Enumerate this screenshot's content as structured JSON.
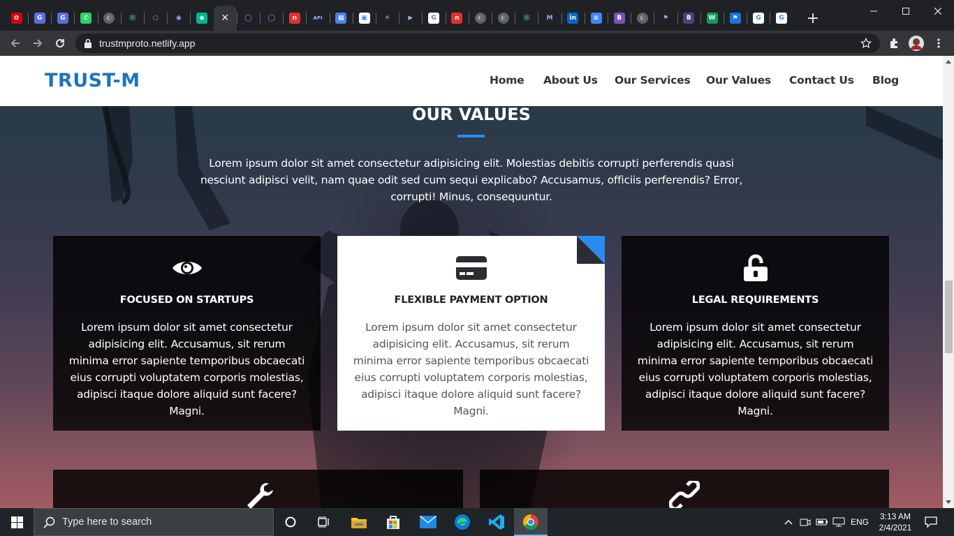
{
  "browser": {
    "tabs": [
      {
        "icon": "huawei-icon",
        "color": "#d7000f",
        "glyph": "✿"
      },
      {
        "icon": "app-icon",
        "color": "#5b6ee1",
        "glyph": "G"
      },
      {
        "icon": "app-icon",
        "color": "#5b6ee1",
        "glyph": "G"
      },
      {
        "icon": "whatsapp-icon",
        "color": "#25d366",
        "glyph": "✆"
      },
      {
        "icon": "globe-icon",
        "color": "#5f6368",
        "glyph": "◐"
      },
      {
        "icon": "react-icon",
        "color": "#202124",
        "glyph": "⚛"
      },
      {
        "icon": "blank-icon",
        "color": "#202124",
        "glyph": "○"
      },
      {
        "icon": "github-icon",
        "color": "#202124",
        "glyph": "◉"
      },
      {
        "icon": "diamond-icon",
        "color": "#00b894",
        "glyph": "◆"
      },
      {
        "icon": "close-icon",
        "color": "#35363a",
        "glyph": "✕"
      },
      {
        "icon": "graphql-icon",
        "color": "#202124",
        "glyph": "⬡"
      },
      {
        "icon": "graphql-icon",
        "color": "#202124",
        "glyph": "⬡"
      },
      {
        "icon": "app-icon",
        "color": "#e03131",
        "glyph": "n"
      },
      {
        "icon": "api-icon",
        "color": "#202124",
        "glyph": "API"
      },
      {
        "icon": "calendar-icon",
        "color": "#4285f4",
        "glyph": "▦"
      },
      {
        "icon": "codesandbox-icon",
        "color": "#ffffff",
        "glyph": "▣"
      },
      {
        "icon": "star-icon",
        "color": "#202124",
        "glyph": "✳"
      },
      {
        "icon": "play-icon",
        "color": "#202124",
        "glyph": "▶"
      },
      {
        "icon": "google-icon",
        "color": "#ffffff",
        "glyph": "G"
      },
      {
        "icon": "app-icon",
        "color": "#e03131",
        "glyph": "n"
      },
      {
        "icon": "globe-icon",
        "color": "#5f6368",
        "glyph": "◐"
      },
      {
        "icon": "globe-icon",
        "color": "#5f6368",
        "glyph": "◐"
      },
      {
        "icon": "react-icon",
        "color": "#202124",
        "glyph": "⚛"
      },
      {
        "icon": "gmail-icon",
        "color": "#202124",
        "glyph": "M"
      },
      {
        "icon": "linkedin-icon",
        "color": "#0a66c2",
        "glyph": "in"
      },
      {
        "icon": "docs-icon",
        "color": "#4285f4",
        "glyph": "≡"
      },
      {
        "icon": "bootstrap-icon",
        "color": "#7952b3",
        "glyph": "B"
      },
      {
        "icon": "globe-icon",
        "color": "#5f6368",
        "glyph": "◐"
      },
      {
        "icon": "flag-icon",
        "color": "#202124",
        "glyph": "⚑"
      },
      {
        "icon": "bootstrap-icon",
        "color": "#563d7c",
        "glyph": "B"
      },
      {
        "icon": "app-icon",
        "color": "#0f9d58",
        "glyph": "W"
      },
      {
        "icon": "flag-icon",
        "color": "#1a73e8",
        "glyph": "⚑"
      },
      {
        "icon": "google-icon",
        "color": "#ffffff",
        "glyph": "G"
      },
      {
        "icon": "google-icon",
        "color": "#ffffff",
        "glyph": "G"
      }
    ],
    "url": "trustmproto.netlify.app"
  },
  "site": {
    "logo": "TRUST-M",
    "nav": [
      "Home",
      "About Us",
      "Our Services",
      "Our Values",
      "Contact Us",
      "Blog"
    ],
    "section_title": "OUR VALUES",
    "intro": "Lorem ipsum dolor sit amet consectetur adipisicing elit. Molestias debitis corrupti perferendis quasi nesciunt adipisci velit, nam quae odit sed cum sequi explicabo? Accusamus, officiis perferendis? Error, corrupti! Minus, consequuntur.",
    "cards": [
      {
        "icon": "eye-icon",
        "title": "FOCUSED ON STARTUPS",
        "text": "Lorem ipsum dolor sit amet consectetur adipisicing elit. Accusamus, sit rerum minima error sapiente temporibus obcaecati eius corrupti voluptatem corporis molestias, adipisci itaque dolore aliquid sunt facere? Magni."
      },
      {
        "icon": "credit-card-icon",
        "title": "FLEXIBLE PAYMENT OPTION",
        "text": "Lorem ipsum dolor sit amet consectetur adipisicing elit. Accusamus, sit rerum minima error sapiente temporibus obcaecati eius corrupti voluptatem corporis molestias, adipisci itaque dolore aliquid sunt facere? Magni."
      },
      {
        "icon": "unlock-icon",
        "title": "LEGAL REQUIREMENTS",
        "text": "Lorem ipsum dolor sit amet consectetur adipisicing elit. Accusamus, sit rerum minima error sapiente temporibus obcaecati eius corrupti voluptatem corporis molestias, adipisci itaque dolore aliquid sunt facere? Magni."
      }
    ],
    "lower_cards": [
      {
        "icon": "wrench-icon"
      },
      {
        "icon": "link-icon"
      }
    ],
    "colors": {
      "brand": "#1e73be",
      "accent": "#1e90ff"
    }
  },
  "taskbar": {
    "search_placeholder": "Type here to search",
    "apps": [
      "cortana-icon",
      "task-view-icon",
      "file-explorer-icon",
      "store-icon",
      "mail-icon",
      "edge-icon",
      "vscode-icon",
      "chrome-icon"
    ],
    "language": "ENG",
    "time": "3:13 AM",
    "date": "2/4/2021"
  }
}
